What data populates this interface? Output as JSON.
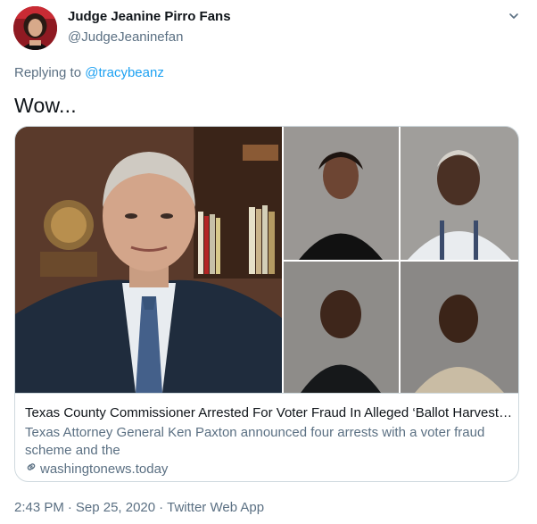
{
  "author": {
    "display_name": "Judge Jeanine Pirro Fans",
    "handle": "@JudgeJeaninefan"
  },
  "reply": {
    "prefix": "Replying to ",
    "to_handle": "@tracybeanz"
  },
  "tweet": {
    "text": "Wow..."
  },
  "card": {
    "title": "Texas County Commissioner Arrested For Voter Fraud In Alleged ‘Ballot Harvesting…",
    "description": "Texas Attorney General Ken Paxton announced four arrests with a voter fraud scheme and the",
    "domain": "washingtonews.today"
  },
  "footer": {
    "time": "2:43 PM",
    "separator": "·",
    "date": "Sep 25, 2020",
    "source": "Twitter Web App"
  },
  "icons": {
    "more": "chevron-down-icon",
    "link": "link-icon"
  },
  "colors": {
    "link_blue": "#1da1f2",
    "secondary_text": "#5b7083",
    "border": "#cfd9de"
  }
}
